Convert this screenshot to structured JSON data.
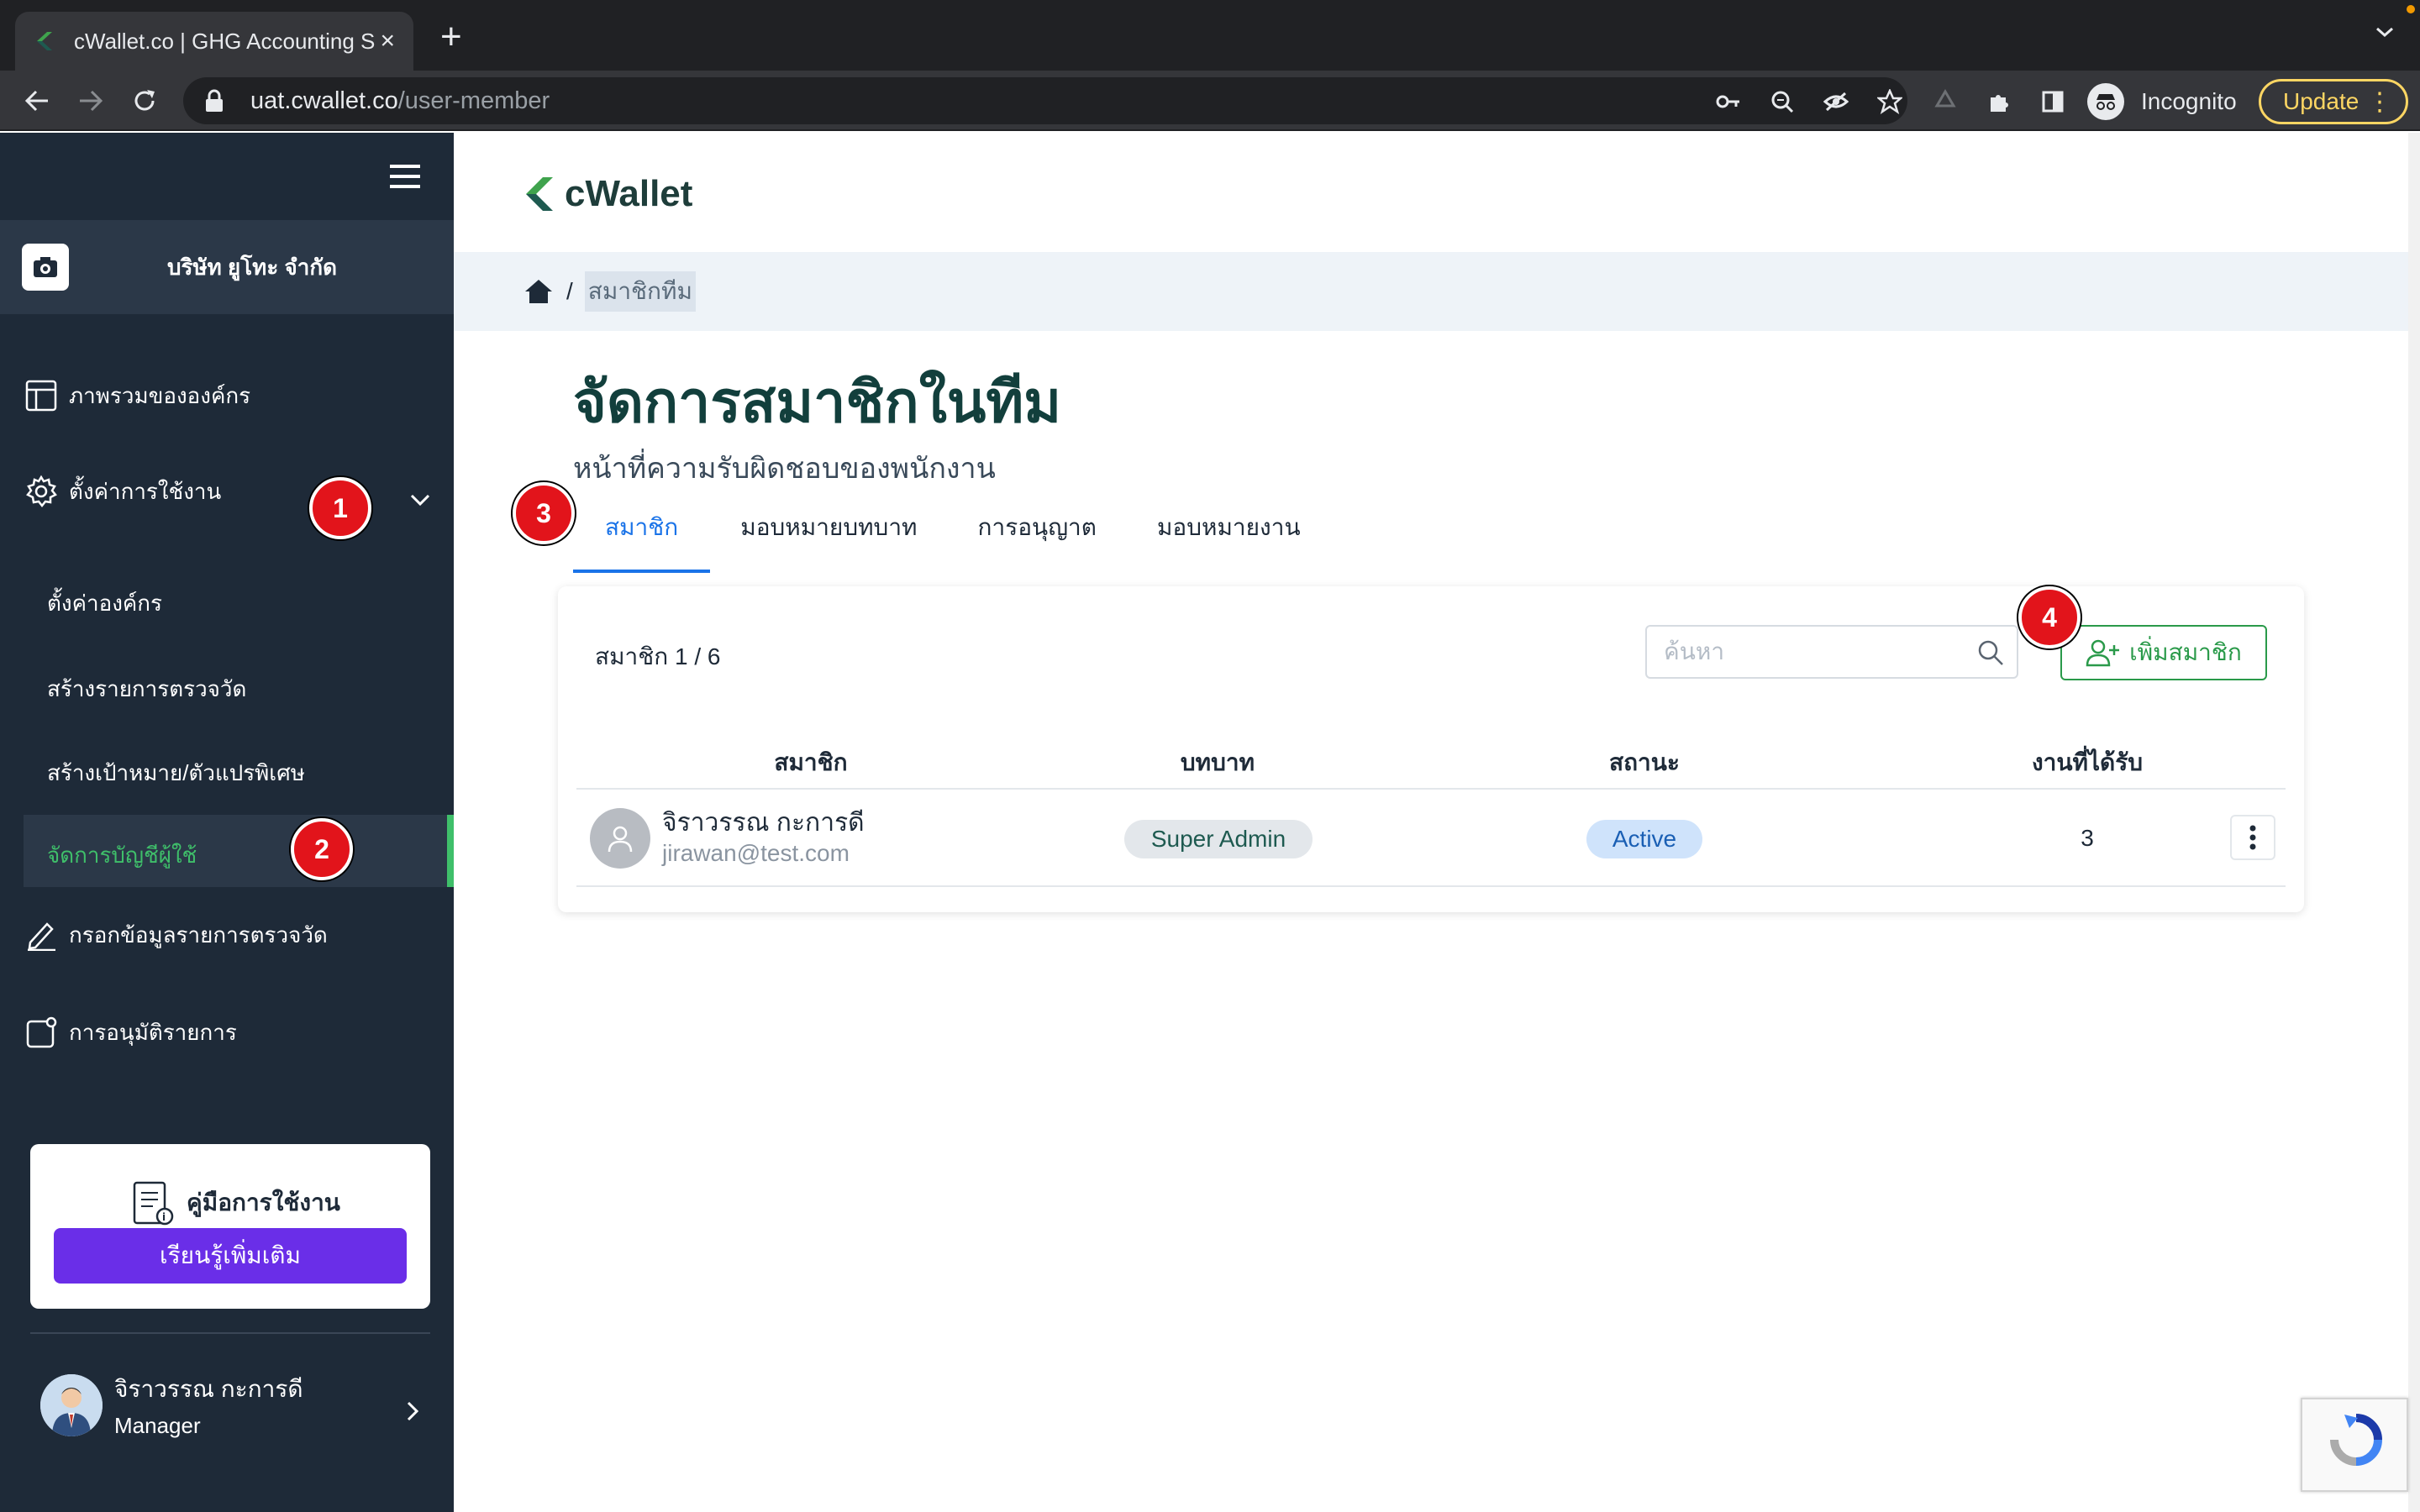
{
  "browser": {
    "tab_title": "cWallet.co | GHG Accounting S",
    "url_host": "uat.cwallet.co",
    "url_path": "/user-member",
    "profile_label": "Incognito",
    "update_label": "Update"
  },
  "sidebar": {
    "company_name": "บริษัท ยูโทะ จำกัด",
    "items": [
      {
        "label": "ภาพรวมขององค์กร",
        "icon": "layout-icon"
      },
      {
        "label": "ตั้งค่าการใช้งาน",
        "icon": "gear-icon"
      },
      {
        "label": "กรอกข้อมูลรายการตรวจวัด",
        "icon": "pencil-icon"
      },
      {
        "label": "การอนุมัติรายการ",
        "icon": "approval-icon"
      }
    ],
    "sub_items": [
      {
        "label": "ตั้งค่าองค์กร"
      },
      {
        "label": "สร้างรายการตรวจวัด"
      },
      {
        "label": "สร้างเป้าหมาย/ตัวแปรพิเศษ"
      },
      {
        "label": "จัดการบัญชีผู้ใช้"
      }
    ],
    "guide": {
      "title": "คู่มือการใช้งาน",
      "button": "เรียนรู้เพิ่มเติม"
    },
    "user": {
      "name": "จิราวรรณ กะการดี",
      "role": "Manager"
    }
  },
  "annotations": {
    "one": "1",
    "two": "2",
    "three": "3",
    "four": "4"
  },
  "main": {
    "brand": "cWallet",
    "breadcrumb_current": "สมาชิกทีม",
    "title": "จัดการสมาชิกในทีม",
    "subtitle": "หน้าที่ความรับผิดชอบของพนักงาน",
    "tabs": [
      {
        "label": "สมาชิก",
        "active": true
      },
      {
        "label": "มอบหมายบทบาท"
      },
      {
        "label": "การอนุญาต"
      },
      {
        "label": "มอบหมายงาน"
      }
    ],
    "member_count": "สมาชิก 1 / 6",
    "search_placeholder": "ค้นหา",
    "add_button": "เพิ่มสมาชิก",
    "columns": [
      "สมาชิก",
      "บทบาท",
      "สถานะ",
      "งานที่ได้รับ"
    ],
    "rows": [
      {
        "name": "จิราวรรณ กะการดี",
        "email": "jirawan@test.com",
        "role": "Super Admin",
        "status": "Active",
        "tasks": "3"
      }
    ]
  },
  "colors": {
    "sidebar_bg": "#1e2a38",
    "accent_green": "#3fbf6a",
    "tab_blue": "#1a73e8",
    "guide_button": "#6a2ee8",
    "badge_red": "#e2141b"
  }
}
